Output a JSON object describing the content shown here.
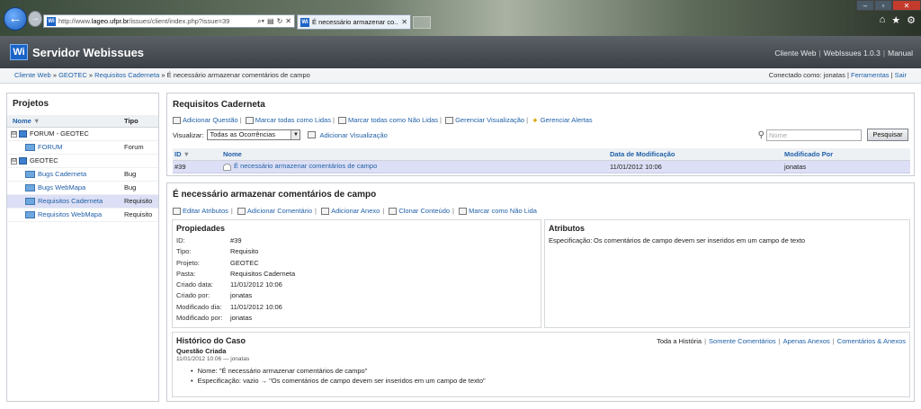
{
  "browser": {
    "url_prefix": "http://www.",
    "url_domain": "lageo.ufpr.br",
    "url_suffix": "/issues/client/index.php?issue=39",
    "tab_title": "É necessário armazenar co...",
    "favicon": "Wi"
  },
  "header": {
    "logo": "Wi",
    "title": "Servidor Webissues",
    "links": [
      "Cliente Web",
      "WebIssues 1.0.3",
      "Manual"
    ]
  },
  "breadcrumb": {
    "items": [
      "Cliente Web",
      "GEOTEC",
      "Requisitos Caderneta"
    ],
    "separator": "»",
    "current": "É necessário armazenar comentários de campo",
    "connected_label": "Conectado como:",
    "user": "jonatas",
    "links": [
      "Ferramentas",
      "Sair"
    ]
  },
  "projects": {
    "title": "Projetos",
    "col_name": "Nome",
    "col_type": "Tipo",
    "rows": [
      {
        "name": "FORUM - GEOTEC",
        "type": "",
        "level": 0
      },
      {
        "name": "FORUM",
        "type": "Forum",
        "level": 1
      },
      {
        "name": "GEOTEC",
        "type": "",
        "level": 0
      },
      {
        "name": "Bugs Caderneta",
        "type": "Bug",
        "level": 1
      },
      {
        "name": "Bugs WebMapa",
        "type": "Bug",
        "level": 1
      },
      {
        "name": "Requisitos Caderneta",
        "type": "Requisito",
        "level": 1
      },
      {
        "name": "Requisitos WebMapa",
        "type": "Requisito",
        "level": 1
      }
    ],
    "toggle_symbol": "⊟"
  },
  "list": {
    "title": "Requisitos Caderneta",
    "toolbar": [
      "Adicionar Questão",
      "Marcar todas como Lidas",
      "Marcar todas como Não Lidas",
      "Gerenciar Visualização",
      "Gerenciar Alertas"
    ],
    "view_label": "Visualizar:",
    "view_value": "Todas as Ocorrências",
    "add_view": "Adicionar Visualização",
    "search_placeholder": "Nome",
    "search_button": "Pesquisar",
    "columns": [
      "ID",
      "Nome",
      "Data de Modificação",
      "Modificado Por"
    ],
    "rows": [
      {
        "id": "#39",
        "name": "É necessário armazenar comentários de campo",
        "modified": "11/01/2012 10:06",
        "by": "jonatas"
      }
    ]
  },
  "detail": {
    "title": "É necessário armazenar comentários de campo",
    "toolbar": [
      "Editar Atributos",
      "Adicionar Comentário",
      "Adicionar Anexo",
      "Clonar Conteúdo",
      "Marcar como Não Lida"
    ],
    "props_title": "Propiedades",
    "props": [
      {
        "k": "ID:",
        "v": "#39"
      },
      {
        "k": "Tipo:",
        "v": "Requisito"
      },
      {
        "k": "Projeto:",
        "v": "GEOTEC"
      },
      {
        "k": "Pasta:",
        "v": "Requisitos Caderneta"
      },
      {
        "k": "Criado data:",
        "v": "11/01/2012 10:06"
      },
      {
        "k": "Criado por:",
        "v": "jonatas"
      },
      {
        "k": "Modificado dia:",
        "v": "11/01/2012 10:06"
      },
      {
        "k": "Modificado por:",
        "v": "jonatas"
      }
    ],
    "attrs_title": "Atributos",
    "attrs": [
      {
        "k": "Especificação:",
        "v": "Os comentários de campo devem ser inseridos em um campo de texto"
      }
    ],
    "history_title": "Histórico do Caso",
    "history_filters": [
      "Toda a História",
      "Somente Comentários",
      "Apenas Anexos",
      "Comentários & Anexos"
    ],
    "history_event": "Questão Criada",
    "history_date": "11/01/2012 10:06",
    "history_dash": "—",
    "history_user": "jonatas",
    "history_changes": [
      "Nome: \"É necessário armazenar comentários de campo\"",
      "Especificação: vazio → \"Os comentários de campo devem ser inseridos em um campo de texto\""
    ]
  },
  "colors": {
    "link": "#1f5fa8",
    "selected_row": "#dcdff5",
    "header_bg": "#3b4046",
    "logo_blue": "#1a63c7"
  }
}
